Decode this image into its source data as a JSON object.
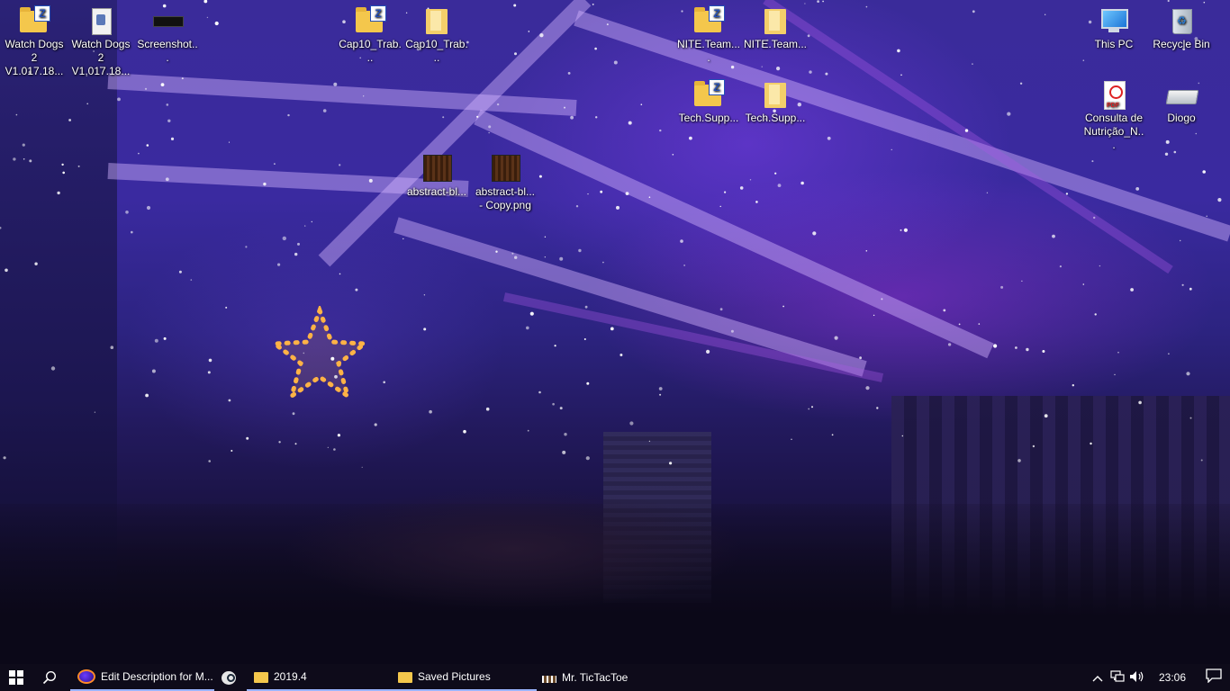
{
  "desktop": {
    "icons": [
      {
        "label": "Watch Dogs 2 V1.017.18...",
        "icon": "zip-folder-icon"
      },
      {
        "label": "Watch Dogs 2 V1.017.18...",
        "icon": "game-installer-icon"
      },
      {
        "label": "Screenshot...",
        "icon": "image-file-icon"
      },
      {
        "label": "Cap10_Trab...",
        "icon": "zip-folder-icon"
      },
      {
        "label": "Cap10_Trab...",
        "icon": "folder-icon"
      },
      {
        "label": "NITE.Team....",
        "icon": "zip-folder-icon"
      },
      {
        "label": "NITE.Team...",
        "icon": "folder-icon"
      },
      {
        "label": "Tech.Supp...",
        "icon": "zip-folder-icon"
      },
      {
        "label": "Tech.Supp...",
        "icon": "folder-icon"
      },
      {
        "label": "abstract-bl...",
        "icon": "image-file-icon"
      },
      {
        "label": "abstract-bl... - Copy.png",
        "icon": "image-file-icon"
      },
      {
        "label": "This PC",
        "icon": "computer-icon"
      },
      {
        "label": "Recycle Bin",
        "icon": "recycle-bin-icon"
      },
      {
        "label": "Consulta de Nutrição_N...",
        "icon": "pdf-file-icon"
      },
      {
        "label": "Diogo",
        "icon": "network-drive-icon"
      }
    ]
  },
  "taskbar": {
    "items": [
      {
        "label": "Edit Description for M...",
        "icon": "firefox-icon",
        "active": true
      },
      {
        "label": "",
        "icon": "steam-icon",
        "active": false
      },
      {
        "label": "2019.4",
        "icon": "folder-icon",
        "active": true
      },
      {
        "label": "Saved Pictures",
        "icon": "folder-icon",
        "active": true
      },
      {
        "label": "Mr. TicTacToe",
        "icon": "app-icon",
        "active": false
      }
    ],
    "tray": {
      "chevron": "^",
      "clock": "23:06"
    }
  },
  "colors": {
    "taskbar_bg": "#0e0b1a",
    "active_indicator": "#9bb4ff",
    "wallpaper_primary": "#3a2b9a"
  }
}
